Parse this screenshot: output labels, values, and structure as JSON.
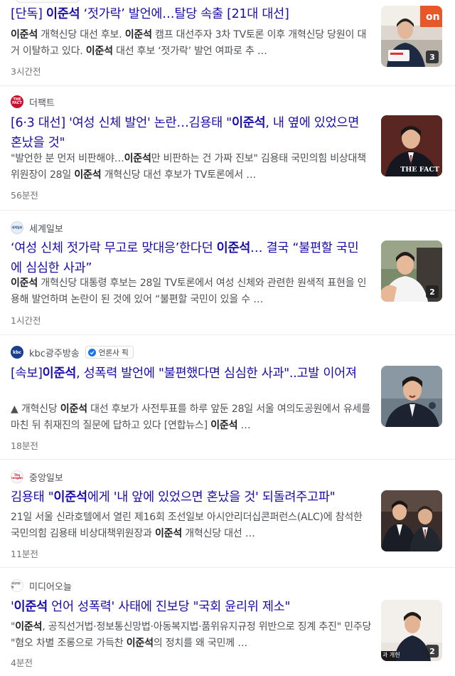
{
  "articles": [
    {
      "source": "",
      "headline_parts": [
        {
          "t": "[단독] ",
          "b": false
        },
        {
          "t": "이준석",
          "b": true
        },
        {
          "t": " ‘젓가락’ 발언에…탈당 속출 [21대 대선]",
          "b": false
        }
      ],
      "snippet_parts": [
        {
          "t": "이준석",
          "b": true
        },
        {
          "t": " 개혁신당 대선 후보. ",
          "b": false
        },
        {
          "t": "이준석",
          "b": true
        },
        {
          "t": " 캠프 대선주자 3차 TV토론 이후 개혁신당 당원이 대거 이탈하고 있다. ",
          "b": false
        },
        {
          "t": "이준석",
          "b": true
        },
        {
          "t": " 대선 후보 ‘젓가락’ 발언 여파로 추 …",
          "b": false
        }
      ],
      "time": "3시간전",
      "image_count": "3"
    },
    {
      "source": "더팩트",
      "favicon_text": "THE FACT",
      "headline_parts": [
        {
          "t": "[6·3 대선] '여성 신체 발언' 논란…김용태 \"",
          "b": false
        },
        {
          "t": "이준석",
          "b": true
        },
        {
          "t": ", 내 옆에 있었으면 혼났을 것\"",
          "b": false
        }
      ],
      "snippet_parts": [
        {
          "t": "\"발언한 분 먼저 비판해야…",
          "b": false
        },
        {
          "t": "이준석",
          "b": true
        },
        {
          "t": "만 비판하는 건 가짜 진보\" 김용태 국민의힘 비상대책위원장이 28일 ",
          "b": false
        },
        {
          "t": "이준석",
          "b": true
        },
        {
          "t": " 개혁신당 대선 후보가 TV토론에서 …",
          "b": false
        }
      ],
      "time": "56분전",
      "image_caption": "THE FACT"
    },
    {
      "source": "세계일보",
      "favicon_text": "세계일보",
      "headline_parts": [
        {
          "t": "‘여성 신체 젓가락 무고로 맞대응’한다던 ",
          "b": false
        },
        {
          "t": "이준석",
          "b": true
        },
        {
          "t": "… 결국 “불편할 국민에 심심한 사과”",
          "b": false
        }
      ],
      "snippet_parts": [
        {
          "t": "이준석",
          "b": true
        },
        {
          "t": " 개혁신당 대통령 후보는 28일 TV토론에서 여성 신체와 관련한 원색적 표현을 인용해 발언하며 논란이 된 것에 있어 “불편할 국민이 있을 수 …",
          "b": false
        }
      ],
      "time": "1시간전",
      "image_count": "2"
    },
    {
      "source": "kbc광주방송",
      "favicon_text": "kbc",
      "press_badge": "언론사 픽",
      "headline_parts": [
        {
          "t": "[속보]",
          "b": false
        },
        {
          "t": "이준석",
          "b": true
        },
        {
          "t": ", 성폭력 발언에 \"불편했다면 심심한 사과\"..고발 이어져",
          "b": false
        }
      ],
      "snippet_parts": [
        {
          "t": "▲ 개혁신당 ",
          "b": false
        },
        {
          "t": "이준석",
          "b": true
        },
        {
          "t": " 대선 후보가 사전투표를 하루 앞둔 28일 서울 여의도공원에서 유세를 마친 뒤 취재진의 질문에 답하고 있다 [연합뉴스] ",
          "b": false
        },
        {
          "t": "이준석",
          "b": true
        },
        {
          "t": " …",
          "b": false
        }
      ],
      "time": "18분전"
    },
    {
      "source": "중앙일보",
      "favicon_text": "The JoongAng",
      "headline_parts": [
        {
          "t": "김용태 \"",
          "b": false
        },
        {
          "t": "이준석",
          "b": true
        },
        {
          "t": "에게 '내 앞에 있었으면 혼났을 것' 되돌려주고파\"",
          "b": false
        }
      ],
      "snippet_parts": [
        {
          "t": "21일 서울 신라호텔에서 열린 제16회 조선일보 아시안리더십콘퍼런스(ALC)에 참석한 국민의힘 김용태 비상대책위원장과 ",
          "b": false
        },
        {
          "t": "이준석",
          "b": true
        },
        {
          "t": " 개혁신당 대선 …",
          "b": false
        }
      ],
      "time": "11분전"
    },
    {
      "source": "미디어오늘",
      "favicon_text": "미디어오늘",
      "headline_parts": [
        {
          "t": "'",
          "b": false
        },
        {
          "t": "이준석",
          "b": true
        },
        {
          "t": " 언어 성폭력' 사태에 진보당 \"국회 윤리위 제소\"",
          "b": false
        }
      ],
      "snippet_parts": [
        {
          "t": "\"",
          "b": false
        },
        {
          "t": "이준석",
          "b": true
        },
        {
          "t": ", 공직선거법·정보통신망법·아동복지법·품위유지규정 위반으로 징계 추진\" 민주당 \"혐오 차별 조롱으로 가득찬 ",
          "b": false
        },
        {
          "t": "이준석",
          "b": true
        },
        {
          "t": "의 정치를 왜 국민께 …",
          "b": false
        }
      ],
      "time": "4분전",
      "image_count": "2",
      "image_caption": "과 개헌"
    }
  ],
  "colors": {
    "headline": "#1a0dab",
    "snippet": "#4d5156",
    "time": "#70757a",
    "divider": "#ececec",
    "badge_blue": "#1a73e8"
  }
}
